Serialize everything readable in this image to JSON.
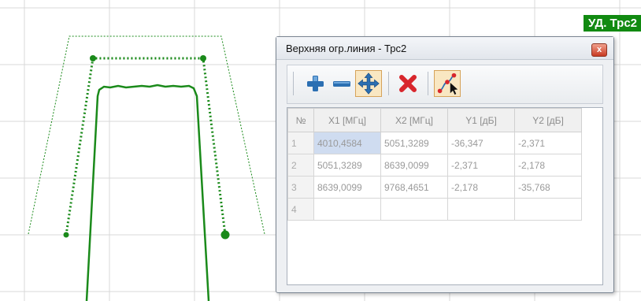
{
  "tag": {
    "label": "УД. Трс2"
  },
  "dialog": {
    "title": "Верхняя огр.линия - Трс2",
    "close_label": "x",
    "toolbar": {
      "buttons": [
        {
          "icon": "plus-icon"
        },
        {
          "icon": "minus-icon"
        },
        {
          "icon": "move-arrows-icon"
        },
        {
          "icon": "delete-x-icon"
        },
        {
          "icon": "edit-points-icon"
        }
      ]
    },
    "table": {
      "columns": [
        "№",
        "X1 [МГц]",
        "X2 [МГц]",
        "Y1 [дБ]",
        "Y2 [дБ]"
      ],
      "rows": [
        {
          "n": "1",
          "x1": "4010,4584",
          "x2": "5051,3289",
          "y1": "-36,347",
          "y2": "-2,371"
        },
        {
          "n": "2",
          "x1": "5051,3289",
          "x2": "8639,0099",
          "y1": "-2,371",
          "y2": "-2,178"
        },
        {
          "n": "3",
          "x1": "8639,0099",
          "x2": "9768,4651",
          "y1": "-2,178",
          "y2": "-35,768"
        },
        {
          "n": "4",
          "x1": "",
          "x2": "",
          "y1": "",
          "y2": ""
        }
      ]
    }
  },
  "colors": {
    "grid": "#d8d8d8",
    "curve": "#1a8a1a",
    "tag_bg": "#118a11",
    "delete": "#d8262c",
    "icon_blue": "#2b6fb2"
  }
}
